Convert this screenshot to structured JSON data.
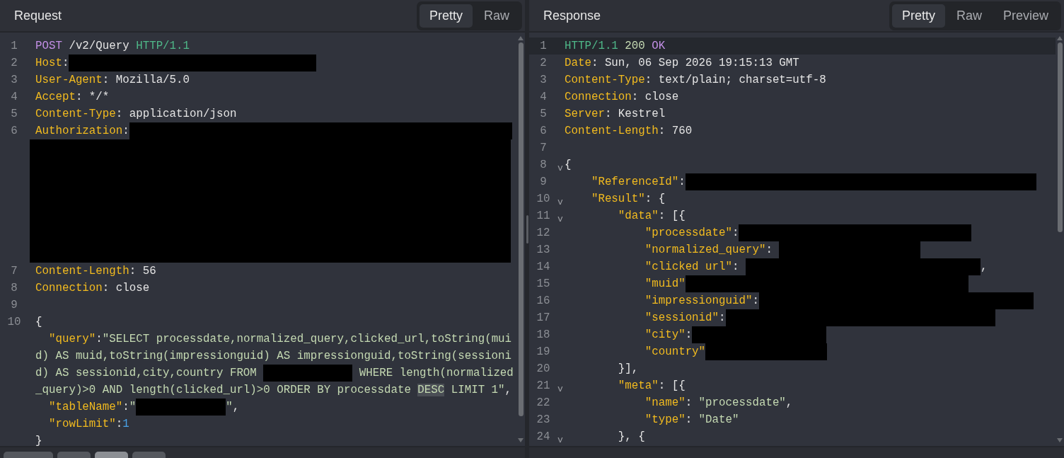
{
  "panels": [
    {
      "title": "Request",
      "tabs": [
        {
          "label": "Pretty",
          "selected": true
        },
        {
          "label": "Raw",
          "selected": false
        }
      ],
      "footer_tabs": [
        {
          "selected": false
        },
        {
          "selected": false
        },
        {
          "selected": true
        },
        {
          "selected": false
        }
      ],
      "lines": [
        {
          "number": "1",
          "active": false,
          "tokens": [
            {
              "kind": "method",
              "text": "POST"
            },
            {
              "kind": "plain",
              "text": " /v2/Query "
            },
            {
              "kind": "version",
              "text": "HTTP/1.1"
            }
          ]
        },
        {
          "number": "2",
          "active": false,
          "tokens": [
            {
              "kind": "key",
              "text": "Host"
            },
            {
              "kind": "plain",
              "text": ":"
            },
            {
              "kind": "redacted"
            }
          ]
        },
        {
          "number": "3",
          "active": false,
          "tokens": [
            {
              "kind": "key",
              "text": "User-Agent"
            },
            {
              "kind": "plain",
              "text": ": Mozilla/5.0"
            }
          ]
        },
        {
          "number": "4",
          "active": false,
          "tokens": [
            {
              "kind": "key",
              "text": "Accept"
            },
            {
              "kind": "plain",
              "text": ": */*"
            }
          ]
        },
        {
          "number": "5",
          "active": false,
          "tokens": [
            {
              "kind": "key",
              "text": "Content-Type"
            },
            {
              "kind": "plain",
              "text": ": application/json"
            }
          ]
        },
        {
          "number": "6",
          "active": false,
          "tokens": [
            {
              "kind": "key",
              "text": "Authorization"
            },
            {
              "kind": "plain",
              "text": ":"
            },
            {
              "kind": "redacted"
            }
          ]
        },
        {
          "active": false,
          "tokens": [
            {
              "kind": "redacted_block"
            }
          ]
        },
        {
          "number": "7",
          "active": false,
          "tokens": [
            {
              "kind": "key",
              "text": "Content-Length"
            },
            {
              "kind": "plain",
              "text": ": 56"
            }
          ]
        },
        {
          "number": "8",
          "active": false,
          "tokens": [
            {
              "kind": "key",
              "text": "Connection"
            },
            {
              "kind": "plain",
              "text": ": close"
            }
          ]
        },
        {
          "number": "9",
          "active": false
        },
        {
          "number": "10",
          "active": false,
          "tokens": [
            {
              "kind": "plain",
              "text": "{"
            }
          ]
        },
        {
          "active": false,
          "tokens": [
            {
              "kind": "key",
              "text": "  \"query\""
            },
            {
              "kind": "plain",
              "text": ":"
            },
            {
              "kind": "string",
              "text": "\"SELECT processdate,normalized_query,clicked_url,toString(mui"
            }
          ]
        },
        {
          "active": false,
          "tokens": [
            {
              "kind": "string",
              "text": "d) AS muid,toString(impressionguid) AS impressionguid,toString(sessioni"
            }
          ]
        },
        {
          "active": false,
          "tokens": [
            {
              "kind": "string",
              "text": "d) AS sessionid,city,country FROM "
            },
            {
              "kind": "redacted"
            },
            {
              "kind": "string",
              "text": " WHERE length(normalized"
            }
          ]
        },
        {
          "active": false,
          "tokens": [
            {
              "kind": "string",
              "text": "_query)>0 AND length(clicked_url)>0 ORDER BY processdate "
            },
            {
              "kind": "highlight",
              "text": "DESC"
            },
            {
              "kind": "string",
              "text": " LIMIT 1\""
            },
            {
              "kind": "plain",
              "text": ","
            }
          ]
        },
        {
          "active": false,
          "tokens": [
            {
              "kind": "key",
              "text": "  \"tableName\""
            },
            {
              "kind": "plain",
              "text": ":"
            },
            {
              "kind": "string",
              "text": "\""
            },
            {
              "kind": "redacted"
            },
            {
              "kind": "string",
              "text": "\""
            },
            {
              "kind": "plain",
              "text": ","
            }
          ]
        },
        {
          "active": false,
          "tokens": [
            {
              "kind": "key",
              "text": "  \"rowLimit\""
            },
            {
              "kind": "plain",
              "text": ":"
            },
            {
              "kind": "number",
              "text": "1"
            }
          ]
        },
        {
          "active": false,
          "tokens": [
            {
              "kind": "plain",
              "text": "}"
            }
          ]
        }
      ]
    },
    {
      "title": "Response",
      "tabs": [
        {
          "label": "Pretty",
          "selected": true
        },
        {
          "label": "Raw",
          "selected": false
        },
        {
          "label": "Preview",
          "selected": false
        }
      ],
      "lines": [
        {
          "number": "1",
          "active": true,
          "tokens": [
            {
              "kind": "version",
              "text": "HTTP/1.1"
            },
            {
              "kind": "status",
              "text": " 200"
            },
            {
              "kind": "method",
              "text": " OK"
            }
          ]
        },
        {
          "number": "2",
          "active": false,
          "tokens": [
            {
              "kind": "key",
              "text": "Date"
            },
            {
              "kind": "plain",
              "text": ": Sun, 06 Sep 2026 19:15:13 GMT"
            }
          ]
        },
        {
          "number": "3",
          "active": false,
          "tokens": [
            {
              "kind": "key",
              "text": "Content-Type"
            },
            {
              "kind": "plain",
              "text": ": text/plain; charset=utf-8"
            }
          ]
        },
        {
          "number": "4",
          "active": false,
          "tokens": [
            {
              "kind": "key",
              "text": "Connection"
            },
            {
              "kind": "plain",
              "text": ": close"
            }
          ]
        },
        {
          "number": "5",
          "active": false,
          "tokens": [
            {
              "kind": "key",
              "text": "Server"
            },
            {
              "kind": "plain",
              "text": ": Kestrel"
            }
          ]
        },
        {
          "number": "6",
          "active": false,
          "tokens": [
            {
              "kind": "key",
              "text": "Content-Length"
            },
            {
              "kind": "plain",
              "text": ": 760"
            }
          ]
        },
        {
          "number": "7",
          "active": false
        },
        {
          "number": "8",
          "fold": "v",
          "active": false,
          "tokens": [
            {
              "kind": "plain",
              "text": "{"
            }
          ]
        },
        {
          "number": "9",
          "active": false,
          "tokens": [
            {
              "kind": "key",
              "text": "    \"ReferenceId\""
            },
            {
              "kind": "plain",
              "text": ":"
            },
            {
              "kind": "redacted"
            }
          ]
        },
        {
          "number": "10",
          "fold": "v",
          "active": false,
          "tokens": [
            {
              "kind": "key",
              "text": "    \"Result\""
            },
            {
              "kind": "plain",
              "text": ": {"
            }
          ]
        },
        {
          "number": "11",
          "fold": "v",
          "active": false,
          "tokens": [
            {
              "kind": "key",
              "text": "        \"data\""
            },
            {
              "kind": "plain",
              "text": ": [{"
            }
          ]
        },
        {
          "number": "12",
          "active": false,
          "tokens": [
            {
              "kind": "key",
              "text": "            \"processdate\""
            },
            {
              "kind": "plain",
              "text": ":"
            },
            {
              "kind": "redacted"
            }
          ]
        },
        {
          "number": "13",
          "active": false,
          "tokens": [
            {
              "kind": "key",
              "text": "            \"normalized_query\""
            },
            {
              "kind": "plain",
              "text": ": "
            },
            {
              "kind": "redacted"
            }
          ]
        },
        {
          "number": "14",
          "active": false,
          "tokens": [
            {
              "kind": "key",
              "text": "            \"clicked url\""
            },
            {
              "kind": "plain",
              "text": ": "
            },
            {
              "kind": "redacted"
            },
            {
              "kind": "plain",
              "text": ","
            }
          ]
        },
        {
          "number": "15",
          "active": false,
          "tokens": [
            {
              "kind": "key",
              "text": "            \"muid\""
            },
            {
              "kind": "redacted"
            }
          ]
        },
        {
          "number": "16",
          "active": false,
          "tokens": [
            {
              "kind": "key",
              "text": "            \"impressionguid\""
            },
            {
              "kind": "plain",
              "text": ":"
            },
            {
              "kind": "redacted"
            }
          ]
        },
        {
          "number": "17",
          "active": false,
          "tokens": [
            {
              "kind": "key",
              "text": "            \"sessionid\""
            },
            {
              "kind": "plain",
              "text": ":"
            },
            {
              "kind": "redacted"
            }
          ]
        },
        {
          "number": "18",
          "active": false,
          "tokens": [
            {
              "kind": "key",
              "text": "            \"city\""
            },
            {
              "kind": "plain",
              "text": ":"
            },
            {
              "kind": "redacted"
            }
          ]
        },
        {
          "number": "19",
          "active": false,
          "tokens": [
            {
              "kind": "key",
              "text": "            \"country\""
            },
            {
              "kind": "redacted"
            }
          ]
        },
        {
          "number": "20",
          "active": false,
          "tokens": [
            {
              "kind": "plain",
              "text": "        }],"
            }
          ]
        },
        {
          "number": "21",
          "fold": "v",
          "active": false,
          "tokens": [
            {
              "kind": "key",
              "text": "        \"meta\""
            },
            {
              "kind": "plain",
              "text": ": [{"
            }
          ]
        },
        {
          "number": "22",
          "active": false,
          "tokens": [
            {
              "kind": "key",
              "text": "            \"name\""
            },
            {
              "kind": "plain",
              "text": ": "
            },
            {
              "kind": "string",
              "text": "\"processdate\""
            },
            {
              "kind": "plain",
              "text": ","
            }
          ]
        },
        {
          "number": "23",
          "active": false,
          "tokens": [
            {
              "kind": "key",
              "text": "            \"type\""
            },
            {
              "kind": "plain",
              "text": ": "
            },
            {
              "kind": "string",
              "text": "\"Date\""
            }
          ]
        },
        {
          "number": "24",
          "fold": "v",
          "active": false,
          "tokens": [
            {
              "kind": "plain",
              "text": "        }, {"
            }
          ]
        }
      ]
    }
  ]
}
